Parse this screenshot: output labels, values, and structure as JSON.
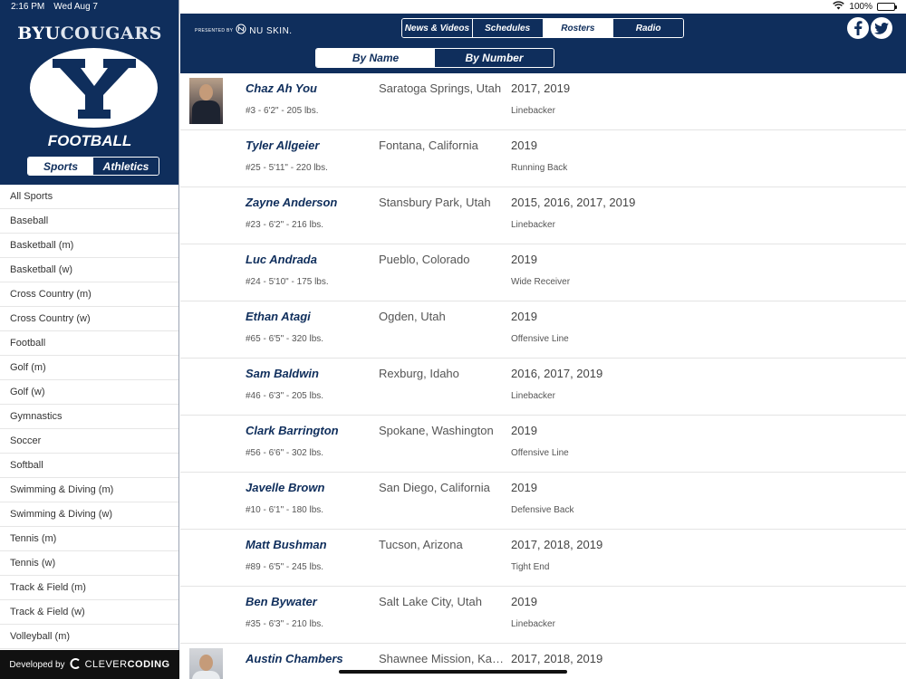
{
  "status": {
    "time": "2:16 PM",
    "date": "Wed Aug 7",
    "battery": "100%",
    "battery_level": 1.0
  },
  "sidebar": {
    "brand_left": "BYU",
    "brand_right": "COUGARS",
    "sport_title": "FOOTBALL",
    "segments": [
      "Sports",
      "Athletics"
    ],
    "active_segment": "Sports",
    "sports": [
      "All Sports",
      "Baseball",
      "Basketball (m)",
      "Basketball (w)",
      "Cross Country (m)",
      "Cross Country (w)",
      "Football",
      "Golf (m)",
      "Golf (w)",
      "Gymnastics",
      "Soccer",
      "Softball",
      "Swimming & Diving (m)",
      "Swimming & Diving (w)",
      "Tennis (m)",
      "Tennis (w)",
      "Track & Field (m)",
      "Track & Field (w)",
      "Volleyball (m)"
    ],
    "footer_prefix": "Developed by",
    "footer_brand_a": "CLEVER",
    "footer_brand_b": "CODING"
  },
  "header": {
    "presented_by": "PRESENTED BY",
    "sponsor": "NU SKIN.",
    "nav_tabs": [
      "News & Videos",
      "Schedules",
      "Rosters",
      "Radio"
    ],
    "active_tab": "Rosters",
    "sort_tabs": [
      "By Name",
      "By Number"
    ],
    "active_sort": "By Name"
  },
  "roster": [
    {
      "name": "Chaz Ah You",
      "stats": "#3 - 6'2\" - 205 lbs.",
      "hometown": "Saratoga Springs, Utah",
      "years": "2017, 2019",
      "position": "Linebacker",
      "photo": "dark"
    },
    {
      "name": "Tyler Allgeier",
      "stats": "#25 - 5'11\" - 220 lbs.",
      "hometown": "Fontana, California",
      "years": "2019",
      "position": "Running Back",
      "photo": ""
    },
    {
      "name": "Zayne Anderson",
      "stats": "#23 - 6'2\" - 216 lbs.",
      "hometown": "Stansbury Park, Utah",
      "years": "2015, 2016, 2017, 2019",
      "position": "Linebacker",
      "photo": ""
    },
    {
      "name": "Luc Andrada",
      "stats": "#24 - 5'10\" - 175 lbs.",
      "hometown": "Pueblo, Colorado",
      "years": "2019",
      "position": "Wide Receiver",
      "photo": ""
    },
    {
      "name": "Ethan Atagi",
      "stats": "#65 - 6'5\" - 320 lbs.",
      "hometown": "Ogden, Utah",
      "years": "2019",
      "position": "Offensive Line",
      "photo": ""
    },
    {
      "name": "Sam Baldwin",
      "stats": "#46 - 6'3\" - 205 lbs.",
      "hometown": "Rexburg, Idaho",
      "years": "2016, 2017, 2019",
      "position": "Linebacker",
      "photo": ""
    },
    {
      "name": "Clark Barrington",
      "stats": "#56 - 6'6\" - 302 lbs.",
      "hometown": "Spokane, Washington",
      "years": "2019",
      "position": "Offensive Line",
      "photo": ""
    },
    {
      "name": "Javelle Brown",
      "stats": "#10 - 6'1\" - 180 lbs.",
      "hometown": "San Diego, California",
      "years": "2019",
      "position": "Defensive Back",
      "photo": ""
    },
    {
      "name": "Matt Bushman",
      "stats": "#89 - 6'5\" - 245 lbs.",
      "hometown": "Tucson, Arizona",
      "years": "2017, 2018, 2019",
      "position": "Tight End",
      "photo": ""
    },
    {
      "name": "Ben Bywater",
      "stats": "#35 - 6'3\" - 210 lbs.",
      "hometown": "Salt Lake City, Utah",
      "years": "2019",
      "position": "Linebacker",
      "photo": ""
    },
    {
      "name": "Austin Chambers",
      "stats": "",
      "hometown": "Shawnee Mission, Kansas",
      "years": "2017, 2018, 2019",
      "position": "",
      "photo": "light"
    }
  ],
  "colors": {
    "navy": "#0f2e5c",
    "white": "#ffffff"
  },
  "icons": {
    "wifi": "wifi-icon",
    "battery": "battery-icon",
    "facebook": "facebook-icon",
    "twitter": "twitter-icon",
    "logo": "byu-y-logo-icon",
    "clevercoding": "clevercoding-logo-icon"
  }
}
